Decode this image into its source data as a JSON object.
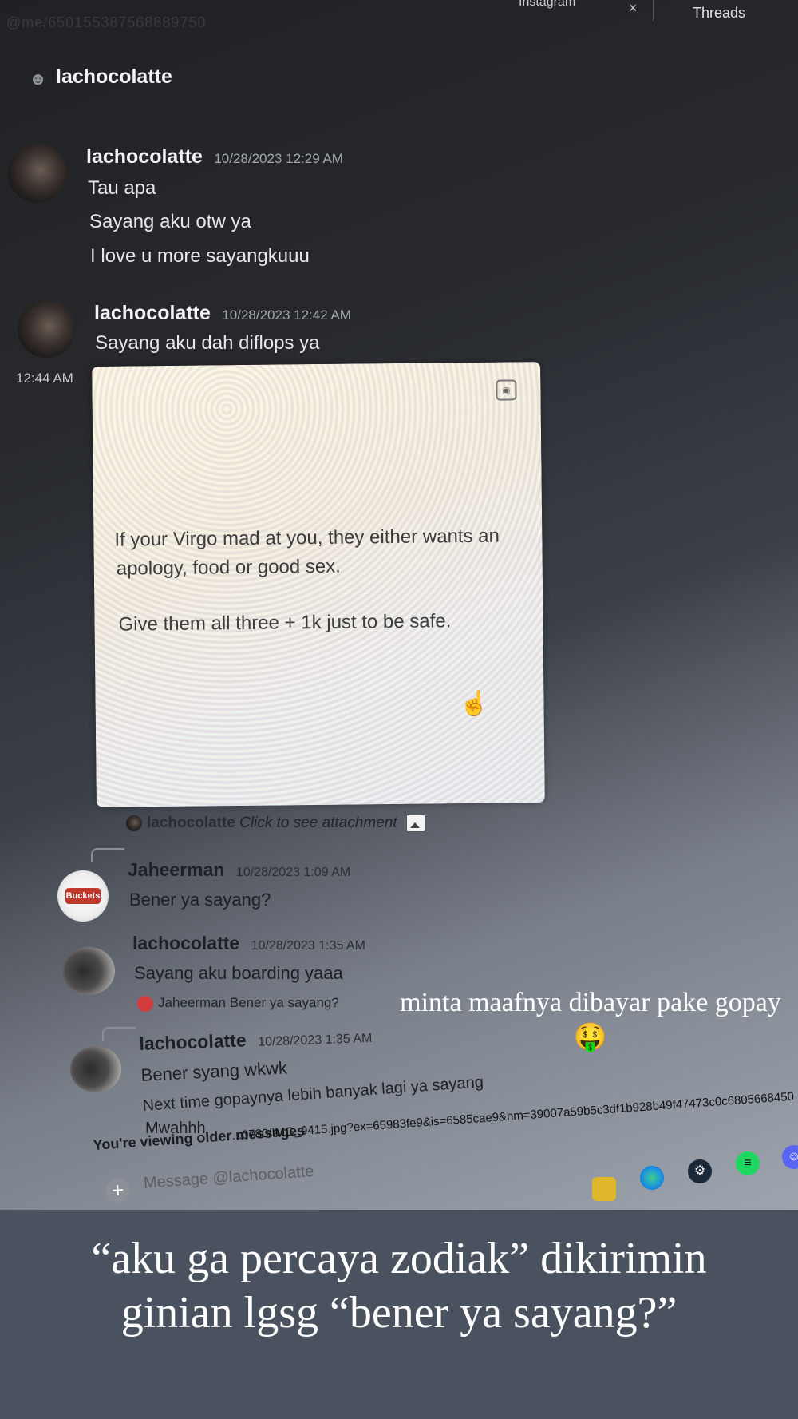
{
  "browser": {
    "url_faint": "@me/650155387568889750",
    "tab_instagram": "Instagram",
    "tab_close": "×",
    "tab_threads": "Threads"
  },
  "dm": {
    "channel_name": "lachocolatte"
  },
  "messages": [
    {
      "author": "lachocolatte",
      "timestamp": "10/28/2023 12:29 AM",
      "lines": [
        "Tau apa",
        "Sayang aku otw ya",
        "I love u more sayangkuuu"
      ]
    },
    {
      "author": "lachocolatte",
      "timestamp": "10/28/2023 12:42 AM",
      "lines": [
        "Sayang aku dah diflops ya"
      ]
    },
    {
      "side_time": "12:44 AM",
      "attachment_lines": [
        "If your Virgo mad at you, they either wants an",
        "apology, food or good sex.",
        "Give them all three + 1k just to be safe."
      ]
    },
    {
      "reply_to_author": "lachocolatte",
      "reply_to_text": "Click to see attachment",
      "author": "Jaheerman",
      "timestamp": "10/28/2023 1:09 AM",
      "avatar_label": "Buckets",
      "lines": [
        "Bener ya sayang?"
      ]
    },
    {
      "author": "lachocolatte",
      "timestamp": "10/28/2023 1:35 AM",
      "lines": [
        "Sayang aku boarding yaaa"
      ]
    },
    {
      "reply_to_author": "Jaheerman",
      "reply_to_text": "Bener ya sayang?",
      "author": "lachocolatte",
      "timestamp": "10/28/2023 1:35 AM",
      "lines": [
        "Bener syang wkwk",
        "Next time gopaynya lebih banyak lagi ya sayang",
        "Mwahhh"
      ]
    }
  ],
  "composer": {
    "older_banner": "You're viewing older messages",
    "placeholder": "Message @lachocolatte",
    "plus": "+"
  },
  "status_url": "...0780/IMG_9415.jpg?ex=65983fe9&is=6585cae9&hm=39007a59b5c3df1b928b49f47473c0c6805668450",
  "story": {
    "overlay_text": "minta maafnya dibayar pake gopay🤑",
    "caption": "“aku ga percaya zodiak” dikirimin ginian lgsg “bener ya sayang?”"
  },
  "colors": {
    "caption_bg": "#4a5260",
    "caption_text": "#ffffff",
    "discord_blurple": "#5865f2",
    "spotify_green": "#1ed760"
  },
  "icons": [
    "user-icon",
    "scan-icon",
    "hand-cursor-icon",
    "image-icon",
    "add-icon",
    "file-explorer-icon",
    "edge-icon",
    "steam-icon",
    "spotify-icon",
    "discord-icon"
  ]
}
